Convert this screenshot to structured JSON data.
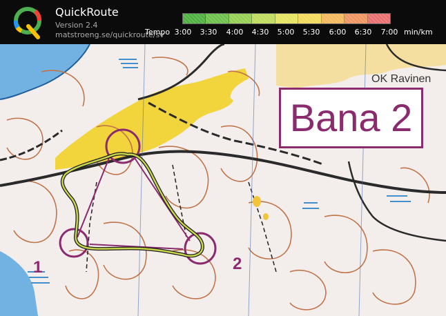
{
  "app": {
    "name": "QuickRoute",
    "version": "Version 2.4",
    "url": "matstroeng.se/quickroute/sv"
  },
  "pace_legend": {
    "label": "Tempo",
    "ticks": [
      "3:00",
      "3:30",
      "4:00",
      "4:30",
      "5:00",
      "5:30",
      "6:00",
      "6:30",
      "7:00"
    ],
    "unit": "min/km",
    "colors": [
      "#4caf3e",
      "#6cc04a",
      "#94cf52",
      "#bfdc5a",
      "#e6e45e",
      "#f3d95b",
      "#f2b85a",
      "#ef945f",
      "#e96e6e"
    ]
  },
  "map": {
    "course_title": "Bana 2",
    "club_label": "OK Ravinen",
    "control_numbers": [
      "2",
      "1"
    ],
    "colors": {
      "course": "#8a2b6e",
      "route": "#c8d64a",
      "open_land": "#f2d43c",
      "contour": "#c0744a",
      "water": "#3f8fcf",
      "road": "#2a2a2a"
    }
  }
}
